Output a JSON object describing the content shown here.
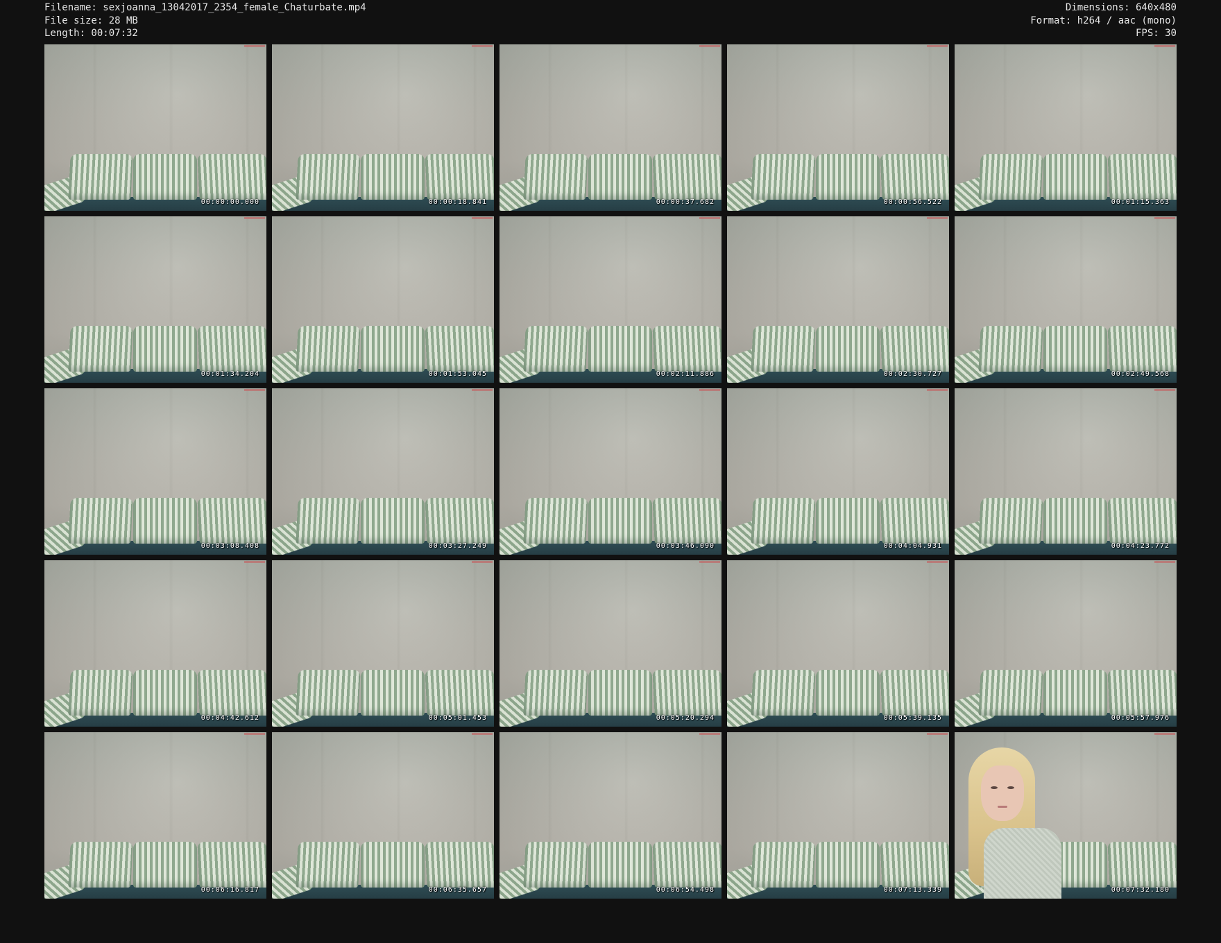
{
  "header": {
    "filename_line": "Filename: sexjoanna_13042017_2354_female_Chaturbate.mp4",
    "filesize_line": "File size: 28 MB",
    "length_line": "Length: 00:07:32",
    "dimensions_line": "Dimensions: 640x480",
    "format_line": "Format: h264 / aac (mono)",
    "fps_line": "FPS: 30"
  },
  "thumbnails": [
    {
      "timestamp": "00:00:00.000",
      "person": false
    },
    {
      "timestamp": "00:00:18.841",
      "person": false
    },
    {
      "timestamp": "00:00:37.682",
      "person": false
    },
    {
      "timestamp": "00:00:56.522",
      "person": false
    },
    {
      "timestamp": "00:01:15.363",
      "person": false
    },
    {
      "timestamp": "00:01:34.204",
      "person": false
    },
    {
      "timestamp": "00:01:53.045",
      "person": false
    },
    {
      "timestamp": "00:02:11.886",
      "person": false
    },
    {
      "timestamp": "00:02:30.727",
      "person": false
    },
    {
      "timestamp": "00:02:49.568",
      "person": false
    },
    {
      "timestamp": "00:03:08.408",
      "person": false
    },
    {
      "timestamp": "00:03:27.249",
      "person": false
    },
    {
      "timestamp": "00:03:46.090",
      "person": false
    },
    {
      "timestamp": "00:04:04.931",
      "person": false
    },
    {
      "timestamp": "00:04:23.772",
      "person": false
    },
    {
      "timestamp": "00:04:42.612",
      "person": false
    },
    {
      "timestamp": "00:05:01.453",
      "person": false
    },
    {
      "timestamp": "00:05:20.294",
      "person": false
    },
    {
      "timestamp": "00:05:39.135",
      "person": false
    },
    {
      "timestamp": "00:05:57.976",
      "person": false
    },
    {
      "timestamp": "00:06:16.817",
      "person": false
    },
    {
      "timestamp": "00:06:35.657",
      "person": false
    },
    {
      "timestamp": "00:06:54.498",
      "person": false
    },
    {
      "timestamp": "00:07:13.339",
      "person": false
    },
    {
      "timestamp": "00:07:32.180",
      "person": true
    }
  ],
  "colors": {
    "background": "#111111",
    "text": "#e6e6e6",
    "timestamp": "#ffffff"
  }
}
